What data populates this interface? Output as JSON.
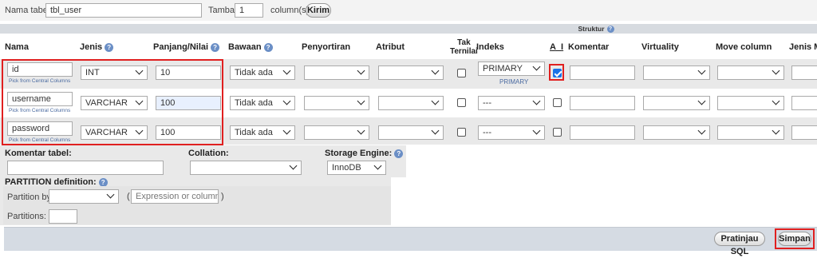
{
  "top": {
    "table_name_label": "Nama tabel:",
    "table_name_value": "tbl_user",
    "add_label": "Tambah",
    "add_count": "1",
    "columns_label": "column(s)",
    "submit_label": "Kirim"
  },
  "structure": {
    "title": "Struktur"
  },
  "headers": {
    "name": "Nama",
    "type": "Jenis",
    "length": "Panjang/Nilai",
    "default": "Bawaan",
    "collation": "Penyortiran",
    "attributes": "Atribut",
    "null_line1": "Tak",
    "null_line2": "Ternilai",
    "index": "Indeks",
    "ai": "A_I",
    "comment": "Komentar",
    "virtuality": "Virtuality",
    "move": "Move column",
    "mime": "Jenis MIM"
  },
  "rows": [
    {
      "name": "id",
      "pick": "Pick from Central Columns",
      "type": "INT",
      "length": "10",
      "default": "Tidak ada",
      "index": "PRIMARY",
      "index_sub": "PRIMARY",
      "ai": true,
      "null": false
    },
    {
      "name": "username",
      "pick": "Pick from Central Columns",
      "type": "VARCHAR",
      "length": "100",
      "default": "Tidak ada",
      "index": "---",
      "index_sub": "",
      "ai": false,
      "null": false
    },
    {
      "name": "password",
      "pick": "Pick from Central Columns",
      "type": "VARCHAR",
      "length": "100",
      "default": "Tidak ada",
      "index": "---",
      "index_sub": "",
      "ai": false,
      "null": false
    }
  ],
  "table_options": {
    "comment_label": "Komentar tabel:",
    "collation_label": "Collation:",
    "engine_label": "Storage Engine:",
    "engine_value": "InnoDB"
  },
  "partition": {
    "title": "PARTITION definition:",
    "by_label": "Partition by:",
    "paren_open": "(",
    "expr_placeholder": "Expression or column list",
    "paren_close": ")",
    "count_label": "Partitions:"
  },
  "footer": {
    "preview_label": "Pratinjau SQL",
    "save_label": "Simpan"
  }
}
